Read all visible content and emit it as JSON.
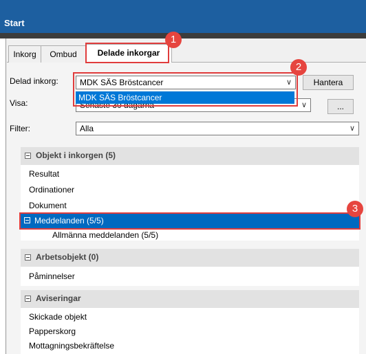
{
  "window": {
    "title": "Start"
  },
  "tabs": [
    {
      "label": "Inkorg"
    },
    {
      "label": "Ombud"
    },
    {
      "label": "Delade inkorgar"
    }
  ],
  "form": {
    "shared_inbox_label": "Delad inkorg:",
    "shared_inbox_value": "MDK SÄS Bröstcancer",
    "dropdown_option": "MDK SÄS Bröstcancer",
    "manage_button": "Hantera",
    "show_label": "Visa:",
    "show_value": "Senaste 30 dagarna",
    "more_button": "...",
    "filter_label": "Filter:",
    "filter_value": "Alla"
  },
  "sections": {
    "inbox": {
      "title": "Objekt i inkorgen (5)",
      "items": [
        "Resultat",
        "Ordinationer",
        "Dokument"
      ],
      "selected": "Meddelanden (5/5)",
      "sub_item": "Allmänna meddelanden (5/5)"
    },
    "work": {
      "title": "Arbetsobjekt (0)",
      "items": [
        "Påminnelser"
      ]
    },
    "notifications": {
      "title": "Aviseringar",
      "items": [
        "Skickade objekt",
        "Papperskorg",
        "Mottagningsbekräftelse"
      ]
    }
  },
  "callouts": [
    "1",
    "2",
    "3"
  ],
  "colors": {
    "accent": "#1d5fa0",
    "selection": "#0069c0",
    "callout": "#e6453f"
  }
}
